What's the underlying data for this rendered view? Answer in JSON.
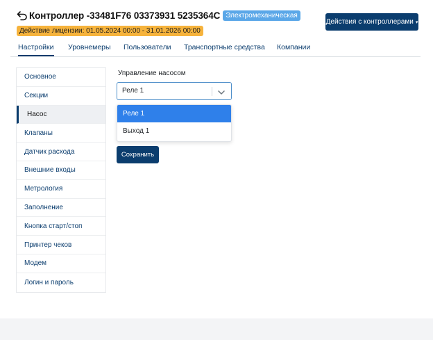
{
  "header": {
    "title": "Контроллер -33481F76 03373931 5235364C",
    "type_badge": "Электромеханическая",
    "license": "Действие лицензии: 01.05.2024 00:00 - 31.01.2026 00:00",
    "actions_button": "Действия с контроллерами",
    "actions_caret": "▾",
    "back_icon": "back-arrow-icon"
  },
  "tabs": [
    {
      "label": "Настройки",
      "active": true
    },
    {
      "label": "Уровнемеры",
      "active": false
    },
    {
      "label": "Пользователи",
      "active": false
    },
    {
      "label": "Транспортные средства",
      "active": false
    },
    {
      "label": "Компании",
      "active": false
    }
  ],
  "sidebar": {
    "items": [
      {
        "label": "Основное"
      },
      {
        "label": "Секции"
      },
      {
        "label": "Насос",
        "active": true
      },
      {
        "label": "Клапаны"
      },
      {
        "label": "Датчик расхода"
      },
      {
        "label": "Внешние входы"
      },
      {
        "label": "Метрология"
      },
      {
        "label": "Заполнение"
      },
      {
        "label": "Кнопка старт/стоп"
      },
      {
        "label": "Принтер чеков"
      },
      {
        "label": "Модем"
      },
      {
        "label": "Логин и пароль"
      }
    ]
  },
  "form": {
    "label": "Управление насосом",
    "selected_value": "Реле 1",
    "options": [
      "Реле 1",
      "Выход 1"
    ],
    "save_button": "Сохранить"
  },
  "colors": {
    "primary": "#0b3d6e",
    "badge_blue": "#5aa7e8",
    "badge_orange": "#f6b33c",
    "option_highlight": "#2f80ea"
  }
}
